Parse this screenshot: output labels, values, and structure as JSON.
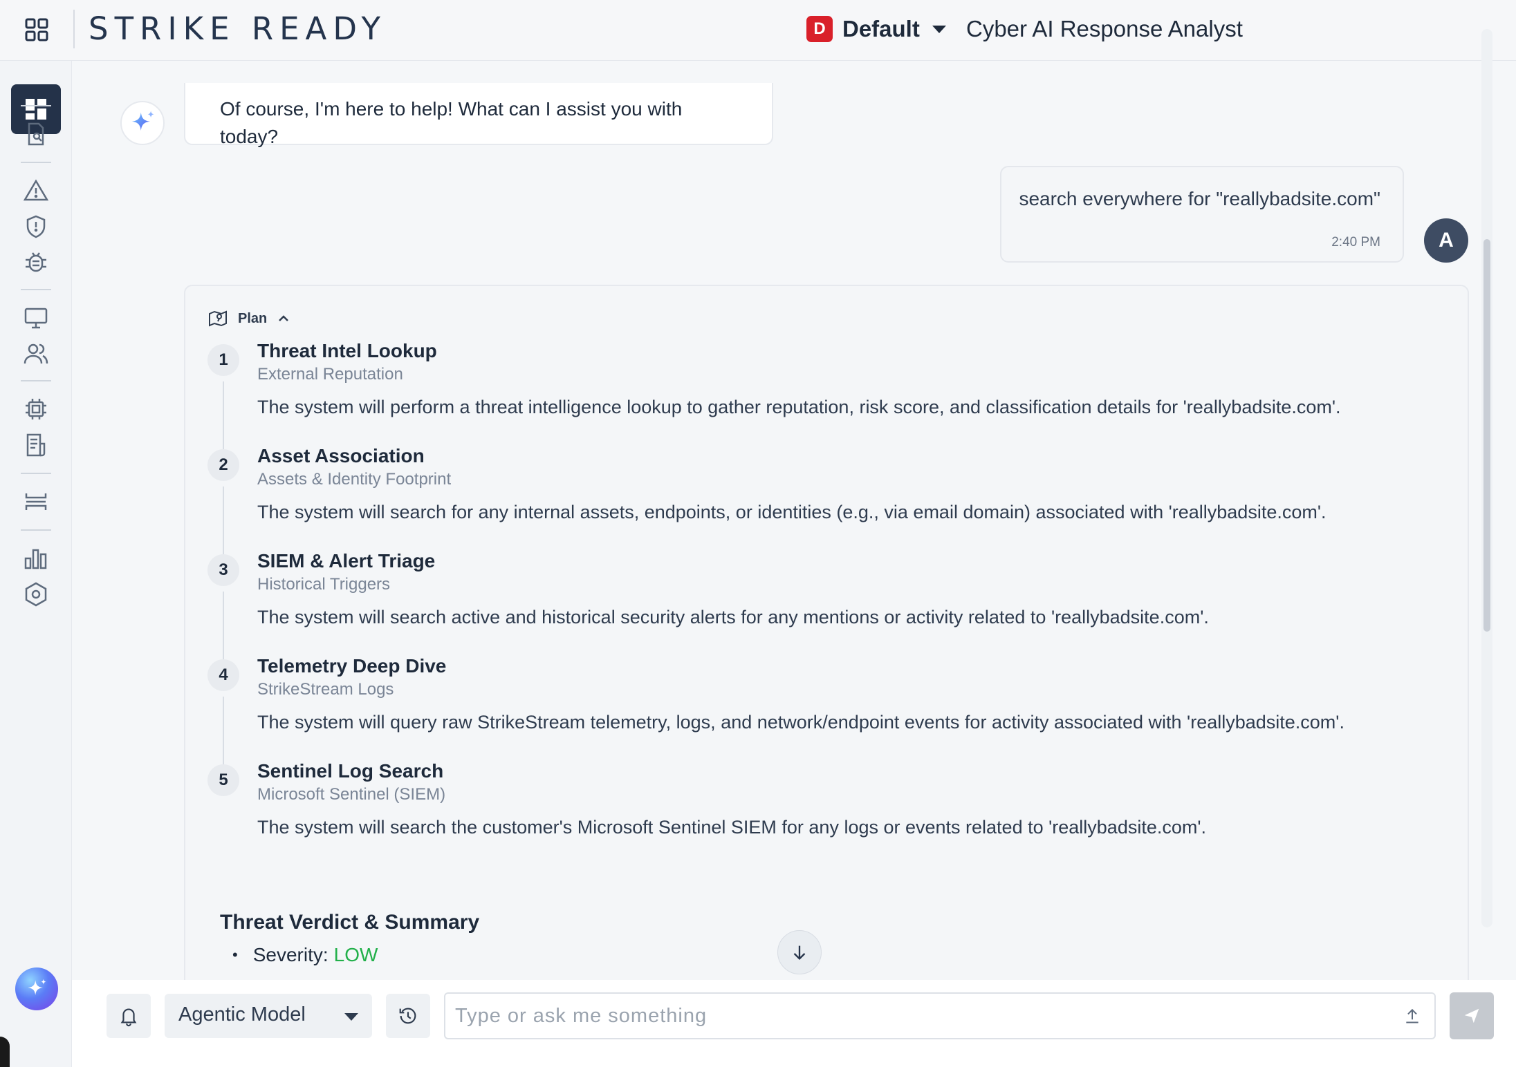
{
  "header": {
    "logo": "STRIKE READY",
    "tenant_badge": "D",
    "tenant_name": "Default",
    "page_title": "Cyber AI Response Analyst"
  },
  "colors": {
    "primary_dark": "#243249",
    "tenant_badge": "#d9202a",
    "severity_low": "#22b04a",
    "user_avatar": "#3e4c63"
  },
  "sidebar": {
    "items": [
      {
        "name": "dashboard",
        "icon": "dashboard-icon",
        "active": true
      },
      {
        "name": "search-report",
        "icon": "document-search-icon"
      },
      {
        "name": "alerts",
        "icon": "warning-icon"
      },
      {
        "name": "security",
        "icon": "shield-icon"
      },
      {
        "name": "threats",
        "icon": "bug-icon"
      },
      {
        "name": "assets",
        "icon": "monitor-icon"
      },
      {
        "name": "users",
        "icon": "users-icon"
      },
      {
        "name": "integrations",
        "icon": "chip-icon"
      },
      {
        "name": "reports",
        "icon": "report-icon"
      },
      {
        "name": "pipelines",
        "icon": "layers-icon"
      },
      {
        "name": "analytics",
        "icon": "bar-chart-icon"
      },
      {
        "name": "settings",
        "icon": "hexagon-settings-icon"
      }
    ],
    "ai_button_icon": "sparkle-icon"
  },
  "chat": {
    "ai_message": "Of course, I'm here to help! What can I assist you with today?",
    "user_message": "search everywhere for \"reallybadsite.com\"",
    "user_time": "2:40 PM",
    "user_initial": "A"
  },
  "plan": {
    "label": "Plan",
    "steps": [
      {
        "num": "1",
        "title": "Threat Intel Lookup",
        "subtitle": "External Reputation",
        "desc": "The system will perform a threat intelligence lookup to gather reputation, risk score, and classification details for 'reallybadsite.com'."
      },
      {
        "num": "2",
        "title": "Asset Association",
        "subtitle": "Assets & Identity Footprint",
        "desc": "The system will search for any internal assets, endpoints, or identities (e.g., via email domain) associated with 'reallybadsite.com'."
      },
      {
        "num": "3",
        "title": "SIEM & Alert Triage",
        "subtitle": "Historical Triggers",
        "desc": "The system will search active and historical security alerts for any mentions or activity related to 'reallybadsite.com'."
      },
      {
        "num": "4",
        "title": "Telemetry Deep Dive",
        "subtitle": "StrikeStream Logs",
        "desc": "The system will query raw StrikeStream telemetry, logs, and network/endpoint events for activity associated with 'reallybadsite.com'."
      },
      {
        "num": "5",
        "title": "Sentinel Log Search",
        "subtitle": "Microsoft Sentinel (SIEM)",
        "desc": "The system will search the customer's Microsoft Sentinel SIEM for any logs or events related to 'reallybadsite.com'."
      }
    ]
  },
  "verdict": {
    "title": "Threat Verdict & Summary",
    "severity_label": "Severity:",
    "severity_value": "LOW"
  },
  "composer": {
    "model": "Agentic Model",
    "placeholder": "Type or ask me something"
  }
}
